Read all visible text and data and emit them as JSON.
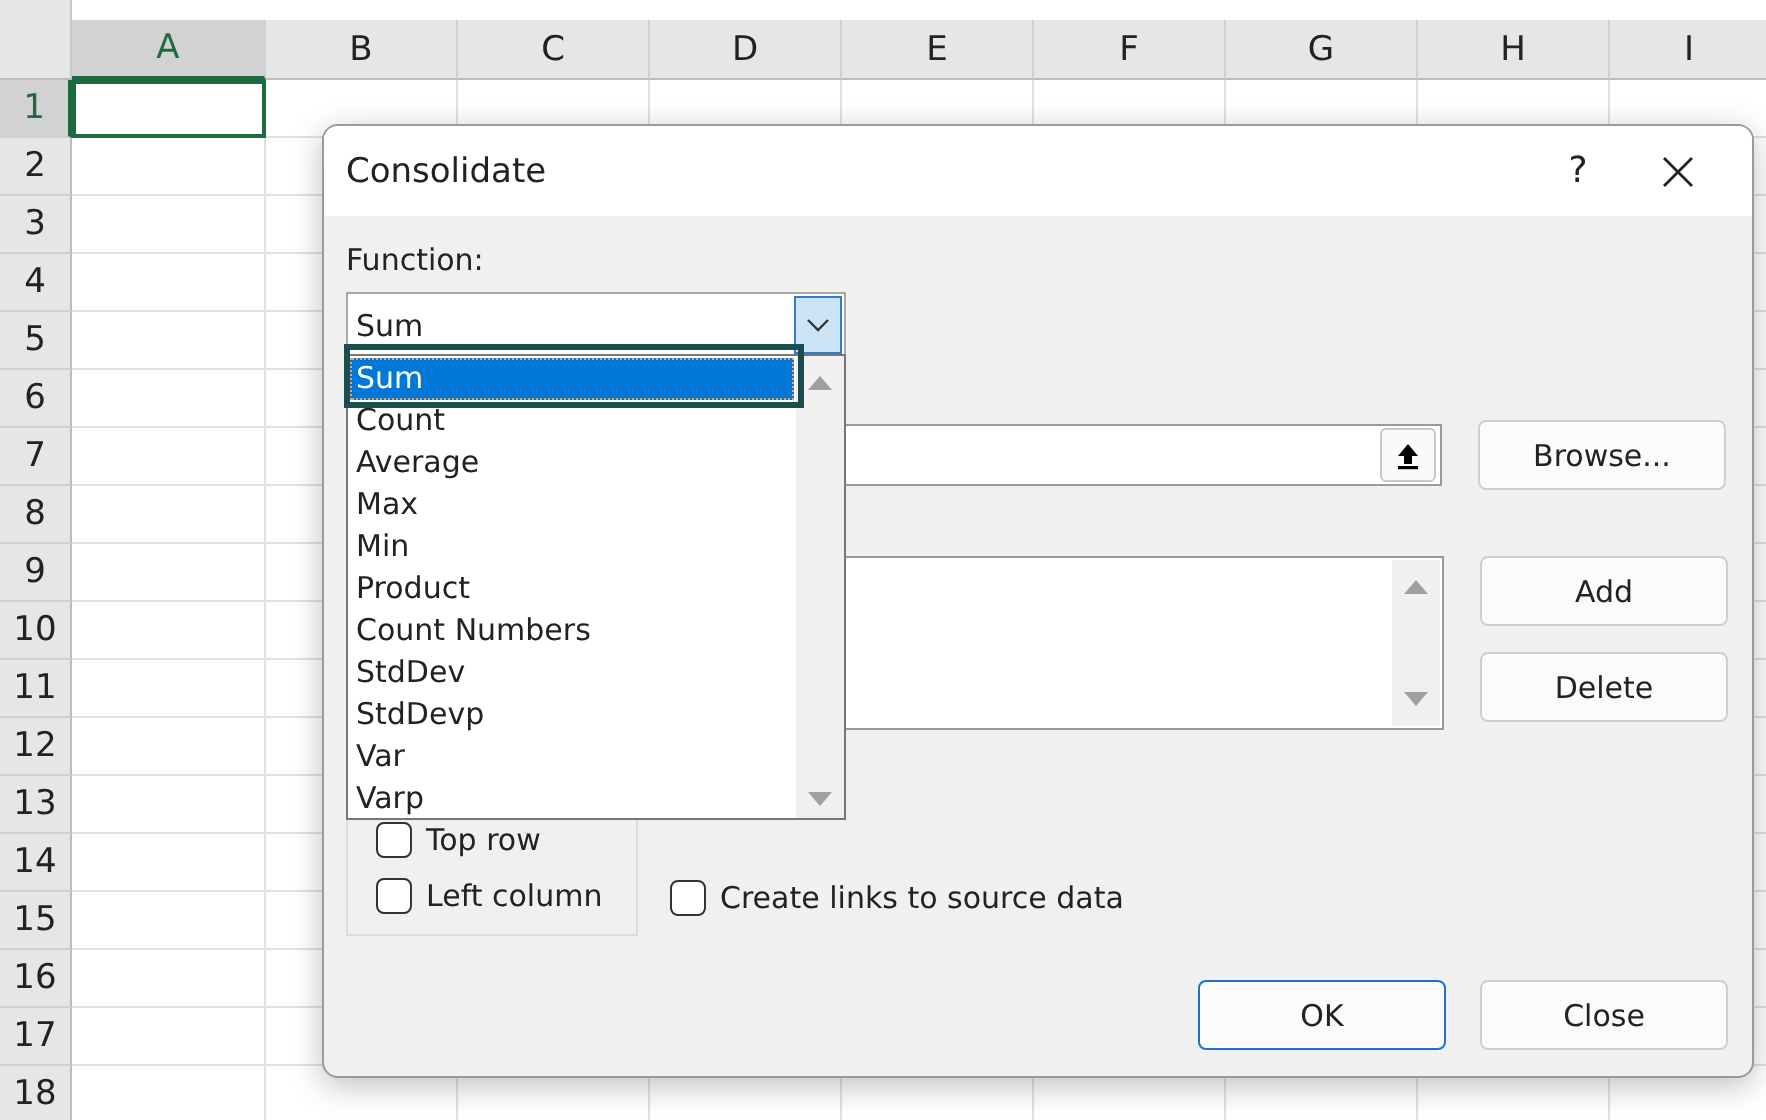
{
  "sheet": {
    "columns": [
      {
        "label": "A",
        "selected": true
      },
      {
        "label": "B",
        "selected": false
      },
      {
        "label": "C",
        "selected": false
      },
      {
        "label": "D",
        "selected": false
      },
      {
        "label": "E",
        "selected": false
      },
      {
        "label": "F",
        "selected": false
      },
      {
        "label": "G",
        "selected": false
      },
      {
        "label": "H",
        "selected": false
      },
      {
        "label": "I",
        "selected": false
      }
    ],
    "rows": [
      {
        "label": "1",
        "selected": true
      },
      {
        "label": "2",
        "selected": false
      },
      {
        "label": "3",
        "selected": false
      },
      {
        "label": "4",
        "selected": false
      },
      {
        "label": "5",
        "selected": false
      },
      {
        "label": "6",
        "selected": false
      },
      {
        "label": "7",
        "selected": false
      },
      {
        "label": "8",
        "selected": false
      },
      {
        "label": "9",
        "selected": false
      },
      {
        "label": "10",
        "selected": false
      },
      {
        "label": "11",
        "selected": false
      },
      {
        "label": "12",
        "selected": false
      },
      {
        "label": "13",
        "selected": false
      },
      {
        "label": "14",
        "selected": false
      },
      {
        "label": "15",
        "selected": false
      },
      {
        "label": "16",
        "selected": false
      },
      {
        "label": "17",
        "selected": false
      },
      {
        "label": "18",
        "selected": false
      }
    ]
  },
  "dialog": {
    "title": "Consolidate",
    "help": "?",
    "function": {
      "label": "Function:",
      "value": "Sum",
      "options": [
        {
          "label": "Sum",
          "selected": true
        },
        {
          "label": "Count",
          "selected": false
        },
        {
          "label": "Average",
          "selected": false
        },
        {
          "label": "Max",
          "selected": false
        },
        {
          "label": "Min",
          "selected": false
        },
        {
          "label": "Product",
          "selected": false
        },
        {
          "label": "Count Numbers",
          "selected": false
        },
        {
          "label": "StdDev",
          "selected": false
        },
        {
          "label": "StdDevp",
          "selected": false
        },
        {
          "label": "Var",
          "selected": false
        },
        {
          "label": "Varp",
          "selected": false
        }
      ]
    },
    "browse_button": "Browse...",
    "add_button": "Add",
    "delete_button": "Delete",
    "use_labels": [
      {
        "label": "Top row",
        "checked": false
      },
      {
        "label": "Left column",
        "checked": false
      }
    ],
    "create_links": {
      "label": "Create links to source data",
      "checked": false
    },
    "buttons": [
      {
        "label": "OK",
        "default": true
      },
      {
        "label": "Close",
        "default": false
      }
    ]
  }
}
